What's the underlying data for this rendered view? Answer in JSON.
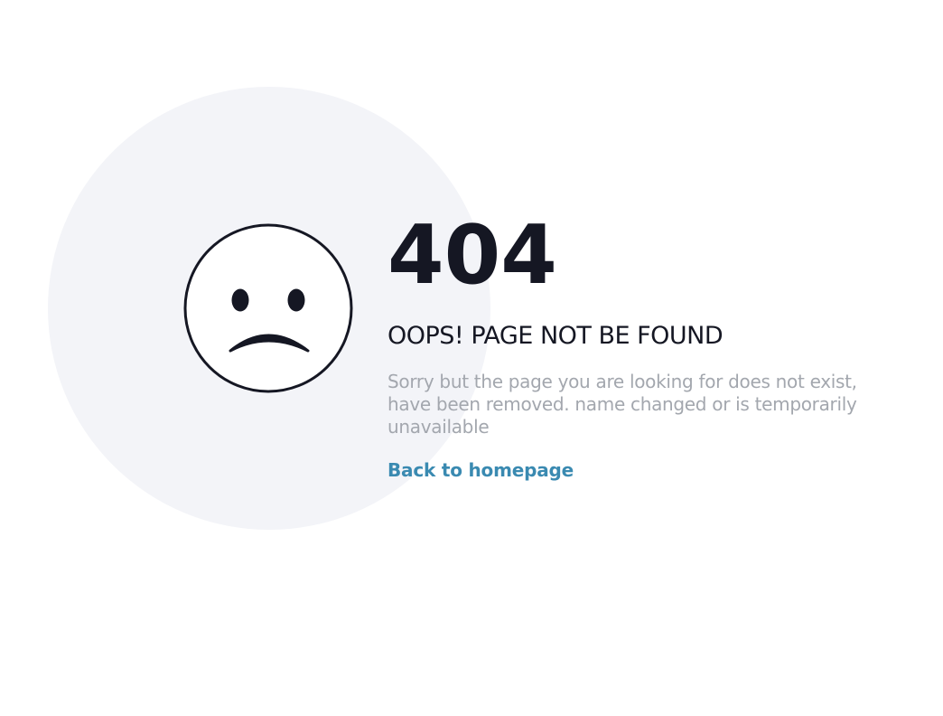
{
  "error": {
    "code": "404",
    "headline": "OOPS! PAGE NOT BE FOUND",
    "description": "Sorry but the page you are looking for does not exist, have been removed. name changed or is temporarily unavailable",
    "link_label": "Back to homepage"
  },
  "icons": {
    "face": "sad-face-icon"
  },
  "colors": {
    "background_circle": "#f3f4f8",
    "text_dark": "#151723",
    "text_muted": "#a3a7ae",
    "link": "#3a8ab1"
  }
}
